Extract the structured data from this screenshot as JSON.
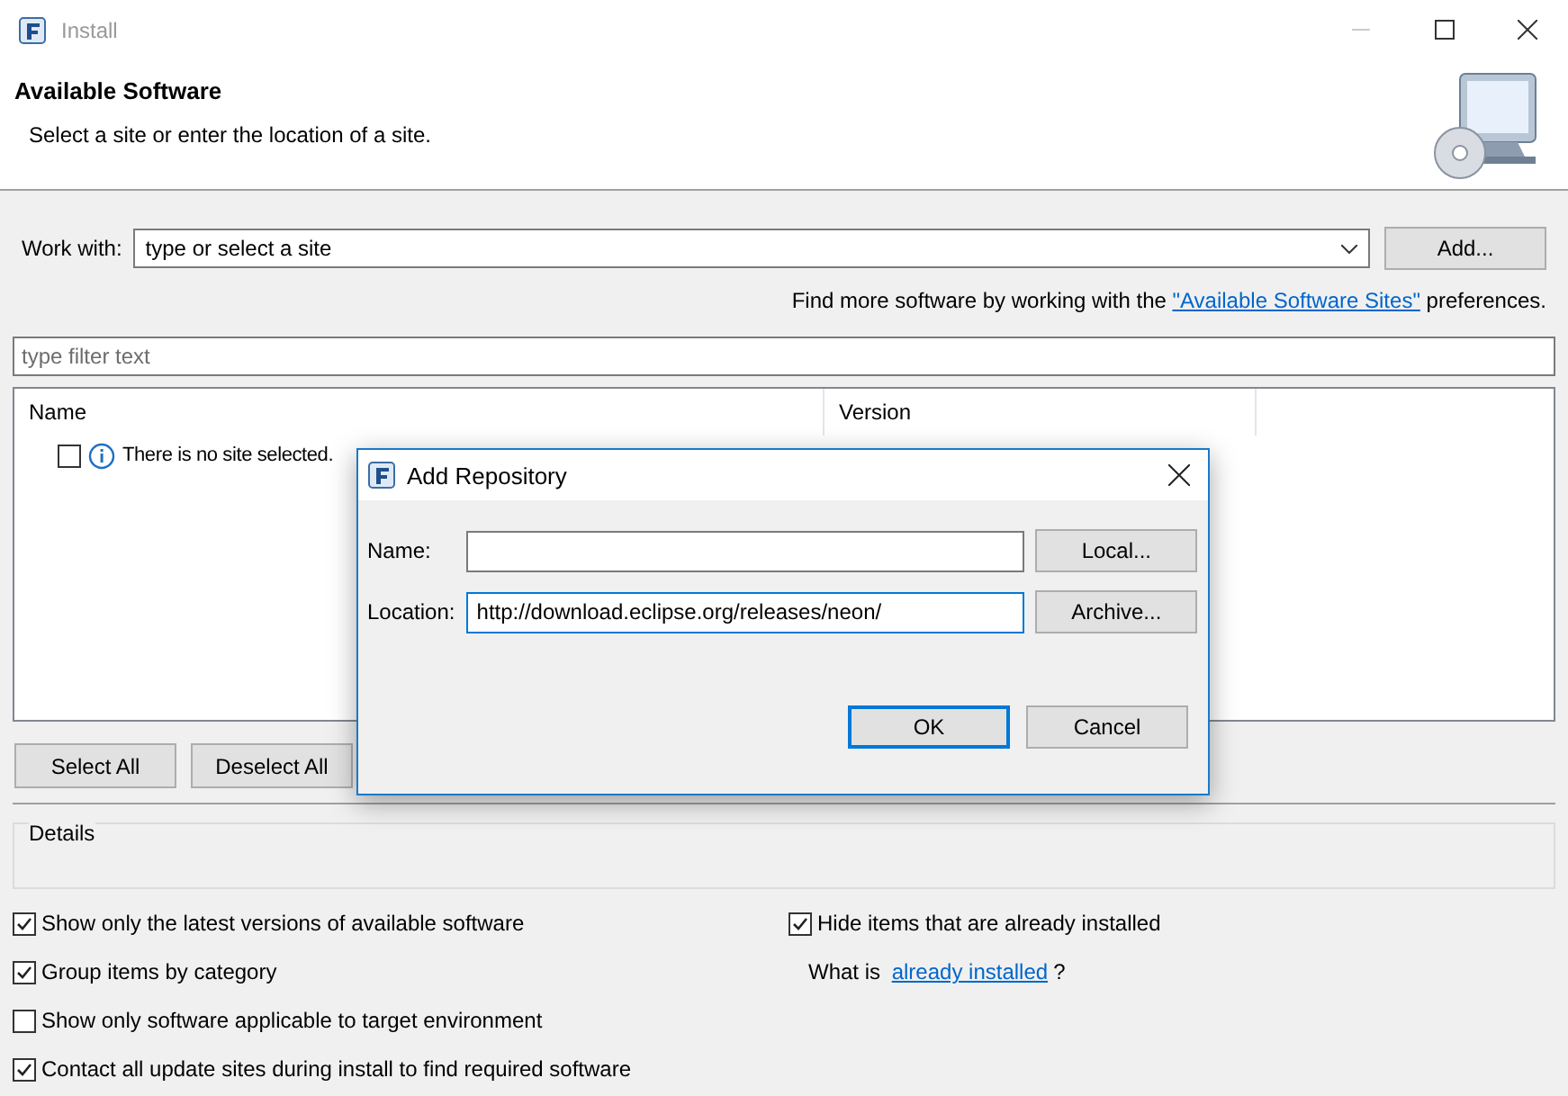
{
  "window": {
    "title": "Install"
  },
  "header": {
    "title": "Available Software",
    "subtitle": "Select a site or enter the location of a site."
  },
  "work_with": {
    "label": "Work with:",
    "value": "type or select a site",
    "button": "Add..."
  },
  "hint": {
    "before": "Find more software by working with the ",
    "link": "\"Available Software Sites\"",
    "after": " preferences."
  },
  "filter": {
    "placeholder": "type filter text"
  },
  "tree": {
    "columns": [
      "Name",
      "Version"
    ],
    "rows": [
      {
        "text": "There is no site selected.",
        "checked": false
      }
    ]
  },
  "buttons": [
    "Select All",
    "Deselect All"
  ],
  "details": {
    "label": "Details"
  },
  "options": [
    {
      "label": "Show only the latest versions of available software",
      "checked": true
    },
    {
      "label": "Group items by category",
      "checked": true
    },
    {
      "label": "Show only software applicable to target environment",
      "checked": false
    },
    {
      "label": "Contact all update sites during install to find required software",
      "checked": true
    }
  ],
  "right_options": {
    "checkbox": {
      "label": "Hide items that are already installed",
      "checked": true
    },
    "before": "What is ",
    "link": "already installed",
    "after": "?"
  },
  "dialog": {
    "title": "Add Repository",
    "fields": [
      {
        "label": "Name:",
        "button": "Local...",
        "focused": false
      },
      {
        "label": "Location:",
        "value": "http://download.eclipse.org/releases/neon/",
        "button": "Archive...",
        "focused": true
      }
    ],
    "buttons": [
      {
        "label": "OK",
        "default": true
      },
      {
        "label": "Cancel",
        "default": false
      }
    ]
  }
}
